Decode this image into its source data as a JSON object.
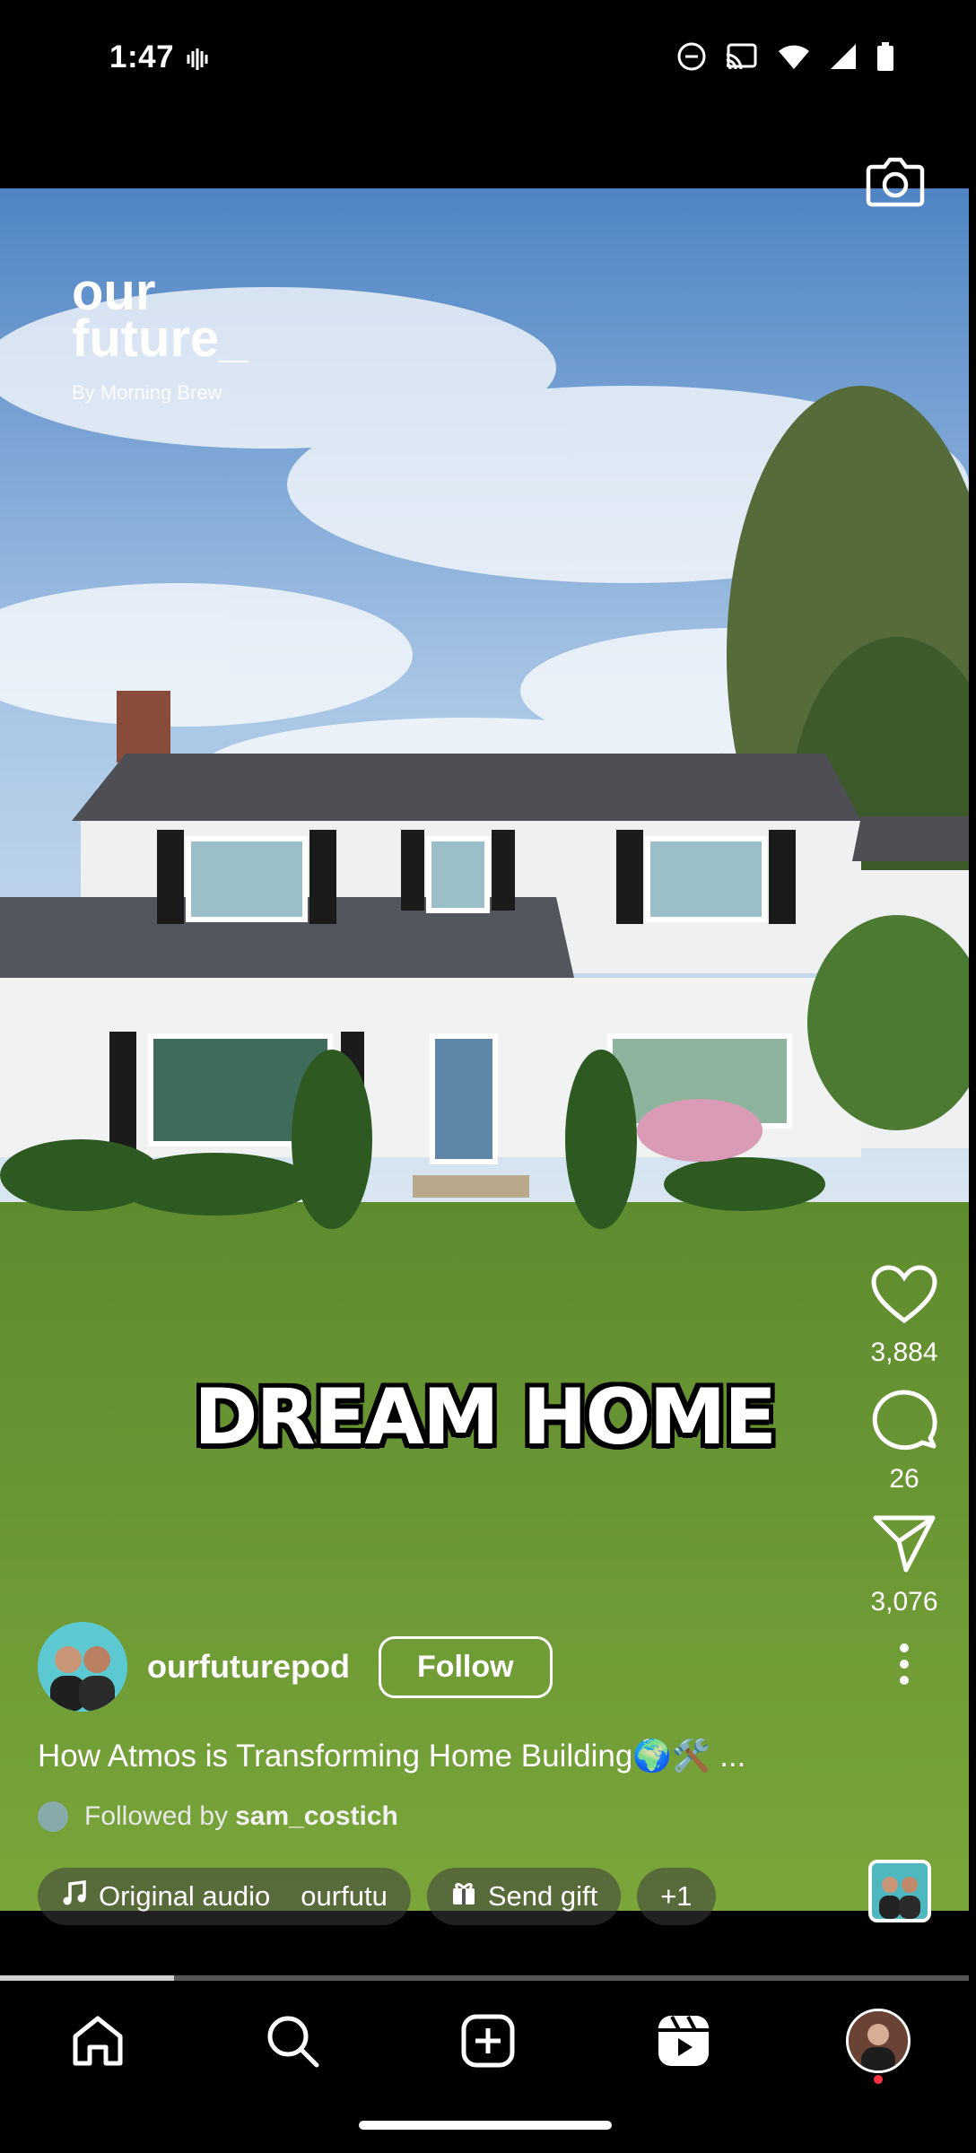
{
  "status_bar": {
    "time": "1:47",
    "icons": [
      "vibrate-icon",
      "dnd-icon",
      "cast-icon",
      "wifi-icon",
      "signal-icon",
      "battery-icon"
    ]
  },
  "video": {
    "logo": {
      "line1": "our",
      "line2": "future_",
      "line3": "By Morning Brew"
    },
    "overlay_text": "DREAM HOME"
  },
  "actions": {
    "likes": "3,884",
    "comments": "26",
    "shares": "3,076"
  },
  "author": {
    "username": "ourfuturepod",
    "follow_label": "Follow"
  },
  "caption": "How Atmos is Transforming Home Building🌍🛠️ ...",
  "followed_by": {
    "prefix": "Followed by",
    "user": "sam_costich"
  },
  "chips": {
    "audio": "Original audio",
    "audio_source": "ourfutu",
    "gift": "Send gift",
    "more": "+1"
  },
  "progress": {
    "played_fraction": 0.18
  },
  "nav": [
    "home-icon",
    "search-icon",
    "create-icon",
    "reels-icon",
    "profile-avatar"
  ]
}
